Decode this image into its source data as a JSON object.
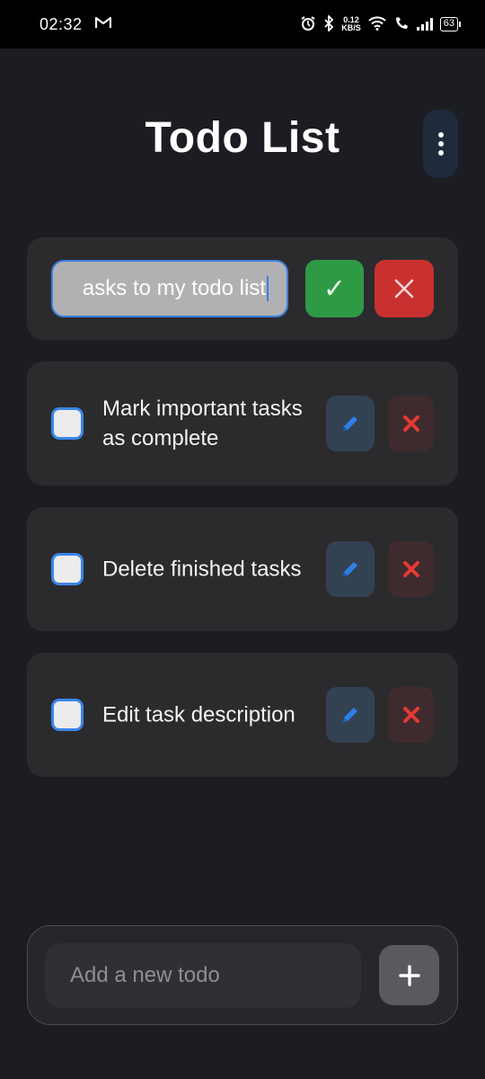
{
  "status_bar": {
    "time": "02:32",
    "mail_icon": "gmail-icon",
    "net_speed_value": "0.12",
    "net_speed_unit": "KB/S",
    "battery": "63"
  },
  "header": {
    "title": "Todo List",
    "menu_icon": "more-vertical-icon"
  },
  "edit_row": {
    "value": "asks to my todo list",
    "confirm_label": "✓",
    "cancel_icon": "close-icon"
  },
  "todos": [
    {
      "text": "Mark important tasks as complete",
      "checked": false
    },
    {
      "text": "Delete finished tasks",
      "checked": false
    },
    {
      "text": "Edit task description",
      "checked": false
    }
  ],
  "add_bar": {
    "placeholder": "Add a new todo",
    "add_icon": "plus-icon"
  },
  "colors": {
    "background": "#1c1d22",
    "card": "#2b2b2e",
    "accent_blue": "#3a86e8",
    "confirm_green": "#2f9a46",
    "cancel_red": "#c8312f",
    "delete_x_red": "#e53935"
  }
}
